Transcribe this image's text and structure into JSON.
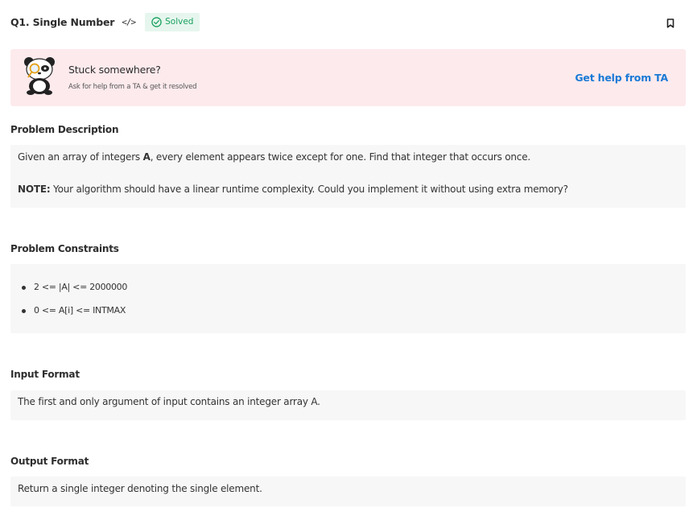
{
  "header": {
    "title": "Q1. Single Number",
    "code_icon": "</>",
    "status": "Solved",
    "icons": {
      "code": "code-icon",
      "check": "check-circle-icon",
      "bookmark": "bookmark-icon"
    }
  },
  "help": {
    "title": "Stuck somewhere?",
    "subtitle": "Ask for help from a TA & get it resolved",
    "link": "Get help from TA",
    "image": "panda-mascot"
  },
  "description": {
    "heading": "Problem Description",
    "line1_pre": "Given an array of integers ",
    "line1_bold": "A",
    "line1_post": ", every element appears twice except for one. Find that integer that occurs once.",
    "note_label": "NOTE:",
    "note_text": " Your algorithm should have a linear runtime complexity. Could you implement it without using extra memory?"
  },
  "constraints": {
    "heading": "Problem Constraints",
    "items": [
      "2 <= |A| <= 2000000",
      "0 <= A[i] <= INTMAX"
    ]
  },
  "input_format": {
    "heading": "Input Format",
    "text": "The first and only argument of input contains an integer array A."
  },
  "output_format": {
    "heading": "Output Format",
    "text": "Return a single integer denoting the single element."
  },
  "colors": {
    "solved_green": "#19a15f",
    "banner_bg": "#fdeaed",
    "link_blue": "#1a7ad6",
    "box_bg": "#f7f7f7"
  }
}
